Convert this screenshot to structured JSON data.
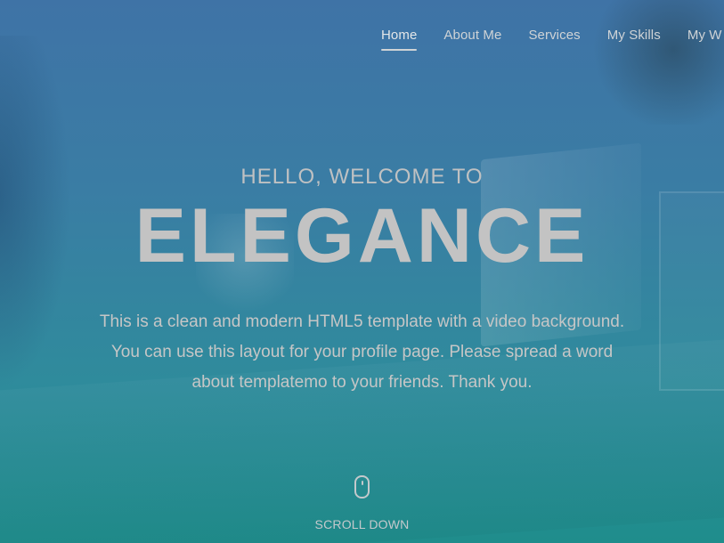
{
  "nav": {
    "items": [
      {
        "label": "Home",
        "active": true
      },
      {
        "label": "About Me",
        "active": false
      },
      {
        "label": "Services",
        "active": false
      },
      {
        "label": "My Skills",
        "active": false
      },
      {
        "label": "My W",
        "active": false
      }
    ]
  },
  "hero": {
    "kicker": "HELLO, WELCOME TO",
    "title": "ELEGANCE",
    "description": "This is a clean and modern HTML5 template with a video background. You can use this layout for your profile page. Please spread a word about templatemo to your friends. Thank you."
  },
  "scroll": {
    "icon": "mouse-icon",
    "label": "SCROLL DOWN"
  },
  "colors": {
    "overlay_top": "#3f73a6",
    "overlay_bottom": "#1f8d8c",
    "text": "#c3c3c3"
  }
}
